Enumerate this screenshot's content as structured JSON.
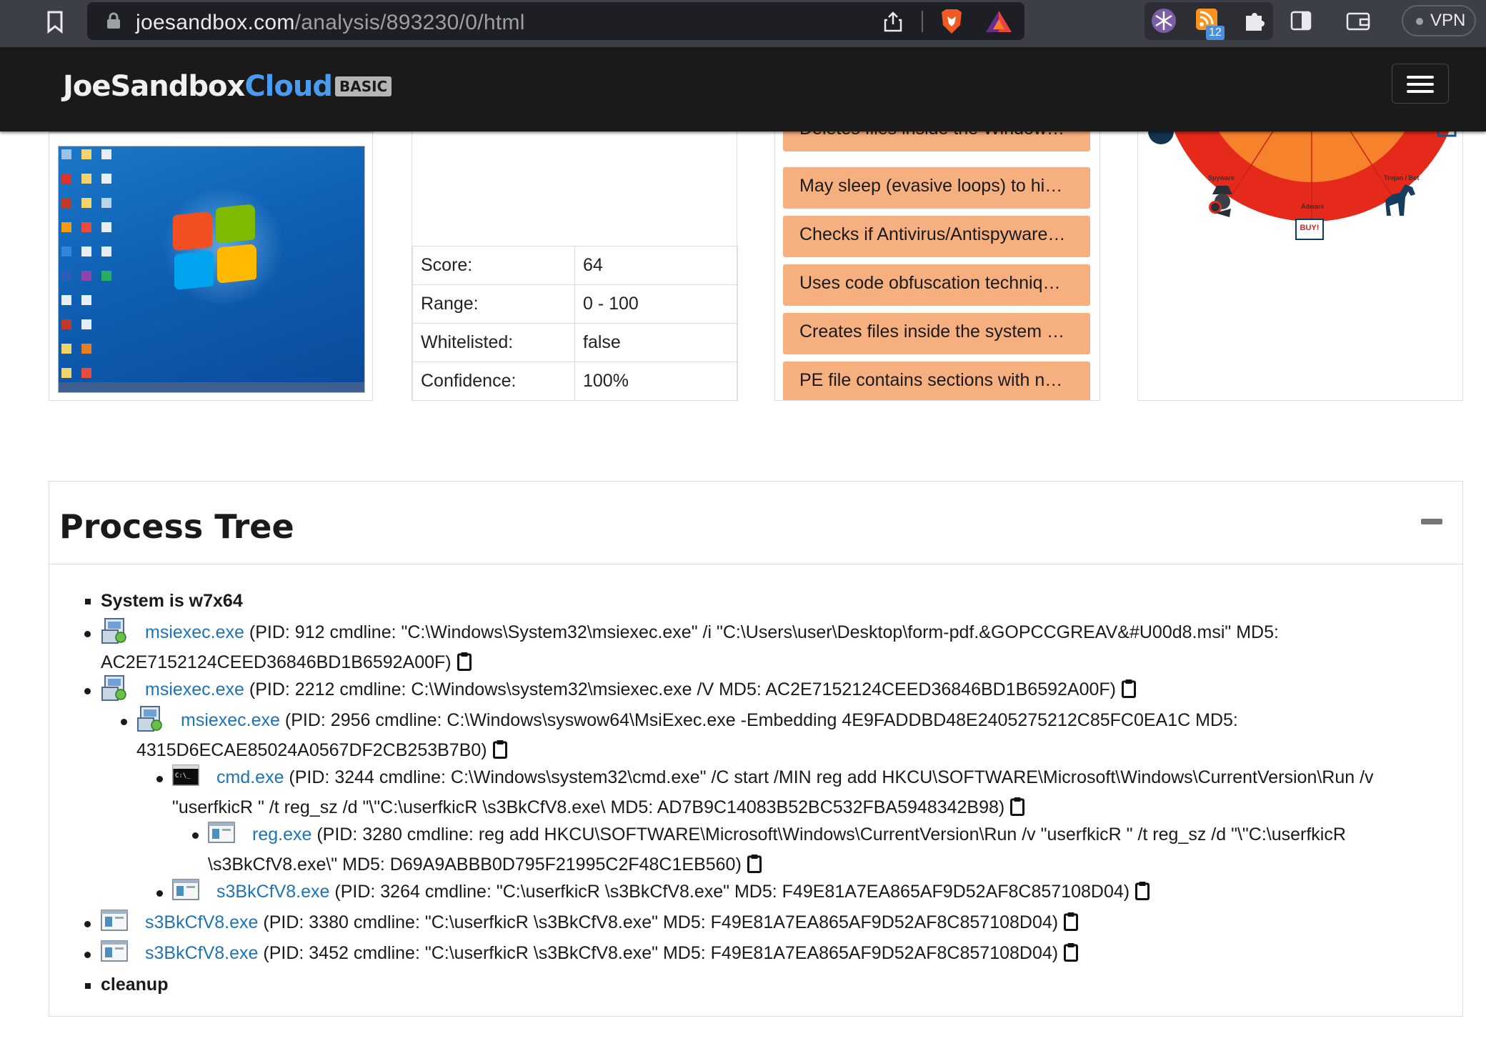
{
  "browser": {
    "url_host": "joesandbox.com",
    "url_path": "/analysis/893230/0/html",
    "rss_badge": "12",
    "vpn_label": "VPN"
  },
  "header": {
    "logo_joe": "J",
    "logo_oe": "oe",
    "logo_sandbox": "Sandbox",
    "logo_cloud": "Cloud",
    "logo_basic": "BASIC"
  },
  "score": {
    "rows": [
      {
        "label": "Score:",
        "value": "64"
      },
      {
        "label": "Range:",
        "value": "0 - 100"
      },
      {
        "label": "Whitelisted:",
        "value": "false"
      },
      {
        "label": "Confidence:",
        "value": "100%"
      }
    ]
  },
  "signatures": [
    "Deletes files inside the Window…",
    "May sleep (evasive loops) to hi…",
    "Checks if Antivirus/Antispyware…",
    "Uses code obfuscation techniq…",
    "Creates files inside the system …",
    "PE file contains sections with n…"
  ],
  "threat_chart": {
    "labels": [
      "Spyware",
      "Adware",
      "Trojan / Bot"
    ],
    "buy_label": "BUY!"
  },
  "process_tree": {
    "title": "Process Tree",
    "system": "System is w7x64",
    "items": [
      {
        "name": "msiexec.exe",
        "line1": " (PID: 912 cmdline: \"C:\\Windows\\System32\\msiexec.exe\" /i \"C:\\Users\\user\\Desktop\\form-pdf.&GOPCCGREAV&#U00d8.msi\" MD5:",
        "line2": "AC2E7152124CEED36846BD1B6592A00F)"
      },
      {
        "name": "msiexec.exe",
        "line1": " (PID: 2212 cmdline: C:\\Windows\\system32\\msiexec.exe /V MD5: AC2E7152124CEED36846BD1B6592A00F)"
      },
      {
        "name": "msiexec.exe",
        "line1": " (PID: 2956 cmdline: C:\\Windows\\syswow64\\MsiExec.exe -Embedding 4E9FADDBD48E2405275212C85FC0EA1C MD5:",
        "line2": "4315D6ECAE85024A0567DF2CB253B7B0)"
      },
      {
        "name": "cmd.exe",
        "line1": " (PID: 3244 cmdline: C:\\Windows\\system32\\cmd.exe\" /C start /MIN reg add HKCU\\SOFTWARE\\Microsoft\\Windows\\CurrentVersion\\Run /v",
        "line2": "\"userfkicR \" /t reg_sz /d \"\\\"C:\\userfkicR \\s3BkCfV8.exe\\ MD5: AD7B9C14083B52BC532FBA5948342B98)"
      },
      {
        "name": "reg.exe",
        "line1": " (PID: 3280 cmdline: reg add HKCU\\SOFTWARE\\Microsoft\\Windows\\CurrentVersion\\Run /v \"userfkicR \" /t reg_sz /d \"\\\"C:\\userfkicR",
        "line2": "\\s3BkCfV8.exe\\\" MD5: D69A9ABBB0D795F21995C2F48C1EB560)"
      },
      {
        "name": "s3BkCfV8.exe",
        "line1": " (PID: 3264 cmdline: \"C:\\userfkicR \\s3BkCfV8.exe\" MD5: F49E81A7EA865AF9D52AF8C857108D04)"
      },
      {
        "name": "s3BkCfV8.exe",
        "line1": " (PID: 3380 cmdline: \"C:\\userfkicR \\s3BkCfV8.exe\" MD5: F49E81A7EA865AF9D52AF8C857108D04)"
      },
      {
        "name": "s3BkCfV8.exe",
        "line1": " (PID: 3452 cmdline: \"C:\\userfkicR \\s3BkCfV8.exe\" MD5: F49E81A7EA865AF9D52AF8C857108D04)"
      }
    ],
    "cleanup": "cleanup"
  },
  "colors": {
    "link": "#1f73b7",
    "signature_bg": "#f6b07f",
    "header_bg": "#1a1a1a",
    "cloud_blue": "#4a9cf0"
  }
}
